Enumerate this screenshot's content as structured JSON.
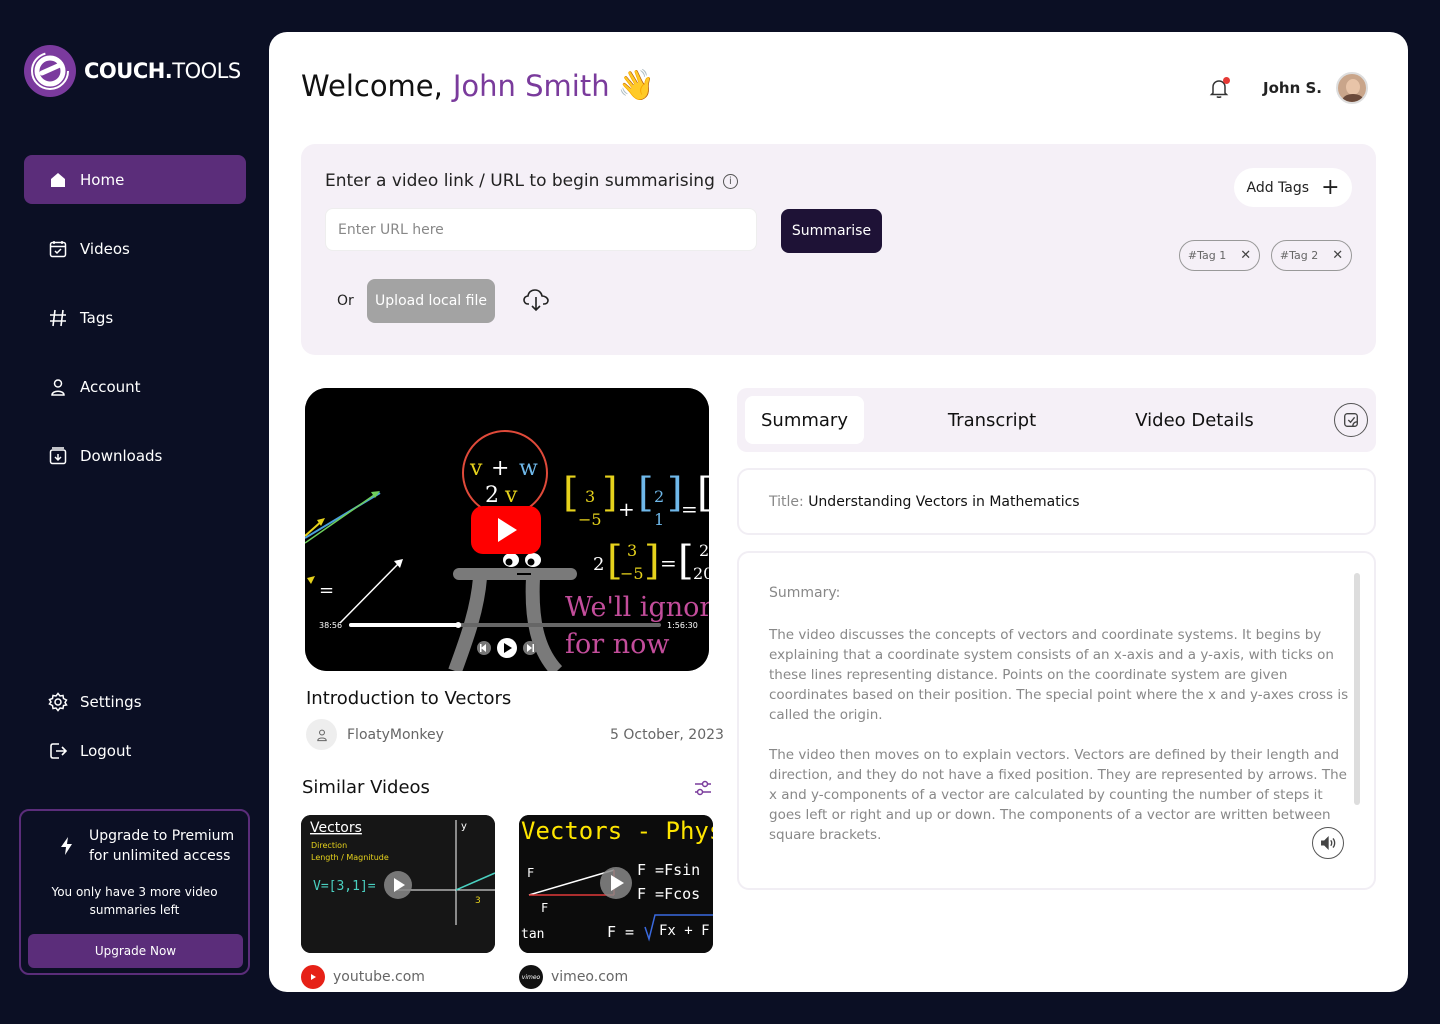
{
  "brand": {
    "name_bold": "COUCH.",
    "name_light": "TOOLS"
  },
  "sidebar": {
    "items": [
      {
        "label": "Home",
        "icon": "home-icon",
        "active": true
      },
      {
        "label": "Videos",
        "icon": "calendar-icon"
      },
      {
        "label": "Tags",
        "icon": "hash-icon"
      },
      {
        "label": "Account",
        "icon": "user-icon"
      },
      {
        "label": "Downloads",
        "icon": "download-box-icon"
      }
    ],
    "bottom_items": [
      {
        "label": "Settings",
        "icon": "gear-icon"
      },
      {
        "label": "Logout",
        "icon": "logout-icon"
      }
    ],
    "upgrade": {
      "title_line1": "Upgrade to Premium",
      "title_line2": "for unlimited access",
      "subtitle": "You only have 3 more video summaries left",
      "button": "Upgrade Now"
    }
  },
  "header": {
    "welcome": "Welcome,",
    "name": "John Smith",
    "wave": "👋",
    "user_short": "John S."
  },
  "url_panel": {
    "title": "Enter a video link / URL to begin summarising",
    "placeholder": "Enter URL here",
    "summarise": "Summarise",
    "or": "Or",
    "upload": "Upload local file",
    "add_tags": "Add Tags",
    "tags": [
      "#Tag 1",
      "#Tag 2"
    ]
  },
  "video": {
    "elapsed": "38:56",
    "duration": "1:56:30",
    "progress": 0.35,
    "title": "Introduction to Vectors",
    "channel": "FloatyMonkey",
    "date": "5 October, 2023",
    "overlay_text1": "We'll ignor",
    "overlay_text2": "for now"
  },
  "similar": {
    "title": "Similar Videos",
    "items": [
      {
        "heading": "Vectors",
        "line1": "Direction",
        "line2": "Length / Magnitude",
        "source": "youtube.com"
      },
      {
        "heading": "Vectors - Physics",
        "source": "vimeo.com"
      }
    ]
  },
  "tabs": [
    "Summary",
    "Transcript",
    "Video Details"
  ],
  "details": {
    "title_label": "Title:",
    "title_value": "Understanding Vectors in Mathematics",
    "summary_label": "Summary:",
    "paragraph1": "The video discusses the concepts of vectors and coordinate systems. It begins by explaining that a coordinate system consists of an x-axis and a y-axis, with ticks on these lines representing distance. Points on the coordinate system are given coordinates based on their position. The special point where the x and y-axes cross is called the origin.",
    "paragraph2": "The video then moves on to explain vectors. Vectors are defined by their length and direction, and they do not have a fixed position. They are represented by arrows. The x and y-components of a vector are calculated by counting the number of steps it goes left or right and up or down. The components of a vector are written between square brackets."
  }
}
